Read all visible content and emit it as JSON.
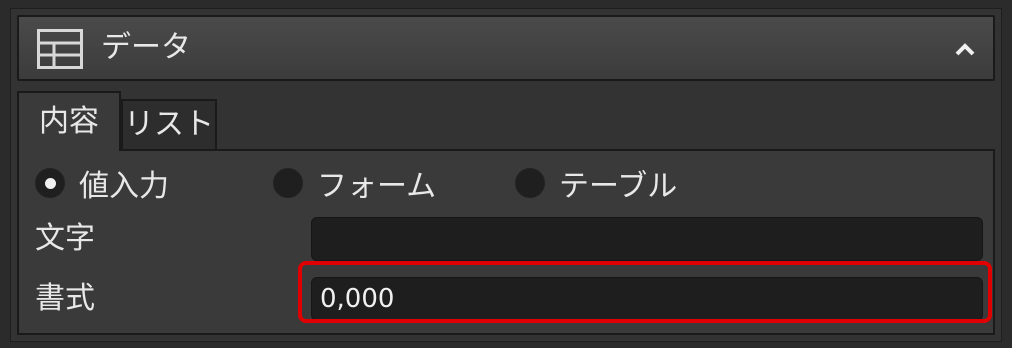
{
  "header": {
    "title": "データ",
    "icon": "table-icon",
    "collapse_icon": "chevron-up-icon"
  },
  "tabs": [
    {
      "label": "内容",
      "active": true
    },
    {
      "label": "リスト",
      "active": false
    }
  ],
  "radio_options": [
    {
      "label": "値入力",
      "selected": true
    },
    {
      "label": "フォーム",
      "selected": false
    },
    {
      "label": "テーブル",
      "selected": false
    }
  ],
  "fields": {
    "text": {
      "label": "文字",
      "value": ""
    },
    "format": {
      "label": "書式",
      "value": "0,000"
    }
  },
  "colors": {
    "highlight": "#e00000",
    "panel": "#333333",
    "input_bg": "#1e1e1e"
  }
}
